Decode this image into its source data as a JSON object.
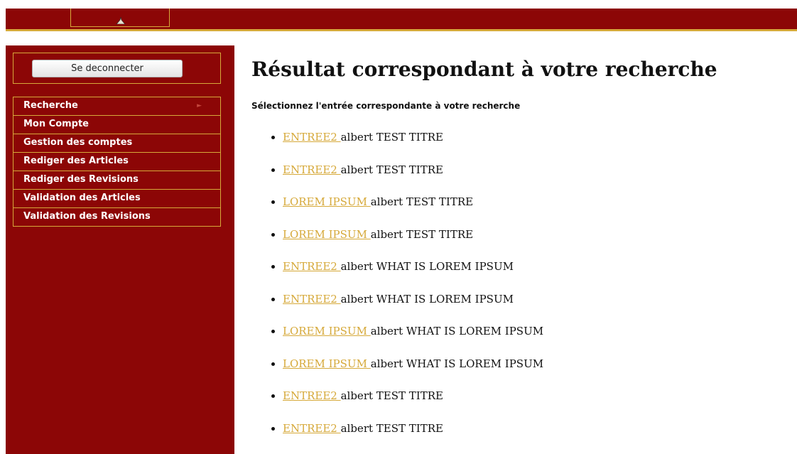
{
  "header": {
    "logo_icon": "logo-figure-icon",
    "colors": {
      "primary": "#8c0606",
      "accent": "#d6a93a"
    }
  },
  "sidebar": {
    "logout_label": "Se deconnecter",
    "menu": [
      {
        "label": "Recherche",
        "has_arrow": true,
        "arrow_icon": "chevron-right-icon"
      },
      {
        "label": "Mon Compte"
      },
      {
        "label": "Gestion des comptes"
      },
      {
        "label": "Rediger des Articles"
      },
      {
        "label": "Rediger des Revisions"
      },
      {
        "label": "Validation des Articles"
      },
      {
        "label": "Validation des Revisions"
      }
    ]
  },
  "main": {
    "title": "Résultat correspondant à votre recherche",
    "subtitle": "Sélectionnez l'entrée correspondante à votre recherche",
    "results": [
      {
        "link": "ENTREE2 ",
        "text": "albert TEST TITRE"
      },
      {
        "link": "ENTREE2 ",
        "text": "albert TEST TITRE"
      },
      {
        "link": "LOREM IPSUM ",
        "text": "albert TEST TITRE"
      },
      {
        "link": "LOREM IPSUM ",
        "text": "albert TEST TITRE"
      },
      {
        "link": "ENTREE2 ",
        "text": "albert WHAT IS LOREM IPSUM"
      },
      {
        "link": "ENTREE2 ",
        "text": "albert WHAT IS LOREM IPSUM"
      },
      {
        "link": "LOREM IPSUM ",
        "text": "albert WHAT IS LOREM IPSUM"
      },
      {
        "link": "LOREM IPSUM ",
        "text": "albert WHAT IS LOREM IPSUM"
      },
      {
        "link": "ENTREE2 ",
        "text": "albert TEST TITRE"
      },
      {
        "link": "ENTREE2 ",
        "text": "albert TEST TITRE"
      }
    ]
  }
}
